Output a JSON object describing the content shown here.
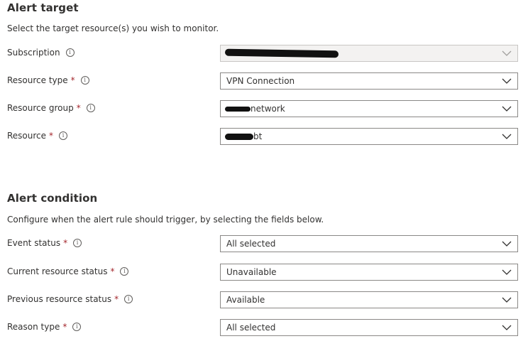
{
  "alert_target": {
    "title": "Alert target",
    "description": "Select the target resource(s) you wish to monitor.",
    "fields": [
      {
        "label": "Subscription",
        "required": false,
        "value": "",
        "disabled": true
      },
      {
        "label": "Resource type",
        "required": true,
        "value": "VPN Connection",
        "disabled": false
      },
      {
        "label": "Resource group",
        "required": true,
        "value": "network",
        "disabled": false
      },
      {
        "label": "Resource",
        "required": true,
        "value": "bt",
        "disabled": false
      }
    ]
  },
  "alert_condition": {
    "title": "Alert condition",
    "description": "Configure when the alert rule should trigger, by selecting the fields below.",
    "fields": [
      {
        "label": "Event status",
        "required": true,
        "value": "All selected"
      },
      {
        "label": "Current resource status",
        "required": true,
        "value": "Unavailable"
      },
      {
        "label": "Previous resource status",
        "required": true,
        "value": "Available"
      },
      {
        "label": "Reason type",
        "required": true,
        "value": "All selected"
      }
    ]
  },
  "icons": {
    "info": "info-icon",
    "chevron": "chevron-down-icon"
  },
  "required_marker": "*",
  "info_glyph": "i",
  "colors": {
    "required": "#a4262c",
    "border": "#8a8886",
    "disabled_bg": "#f3f2f1",
    "text": "#323130"
  }
}
